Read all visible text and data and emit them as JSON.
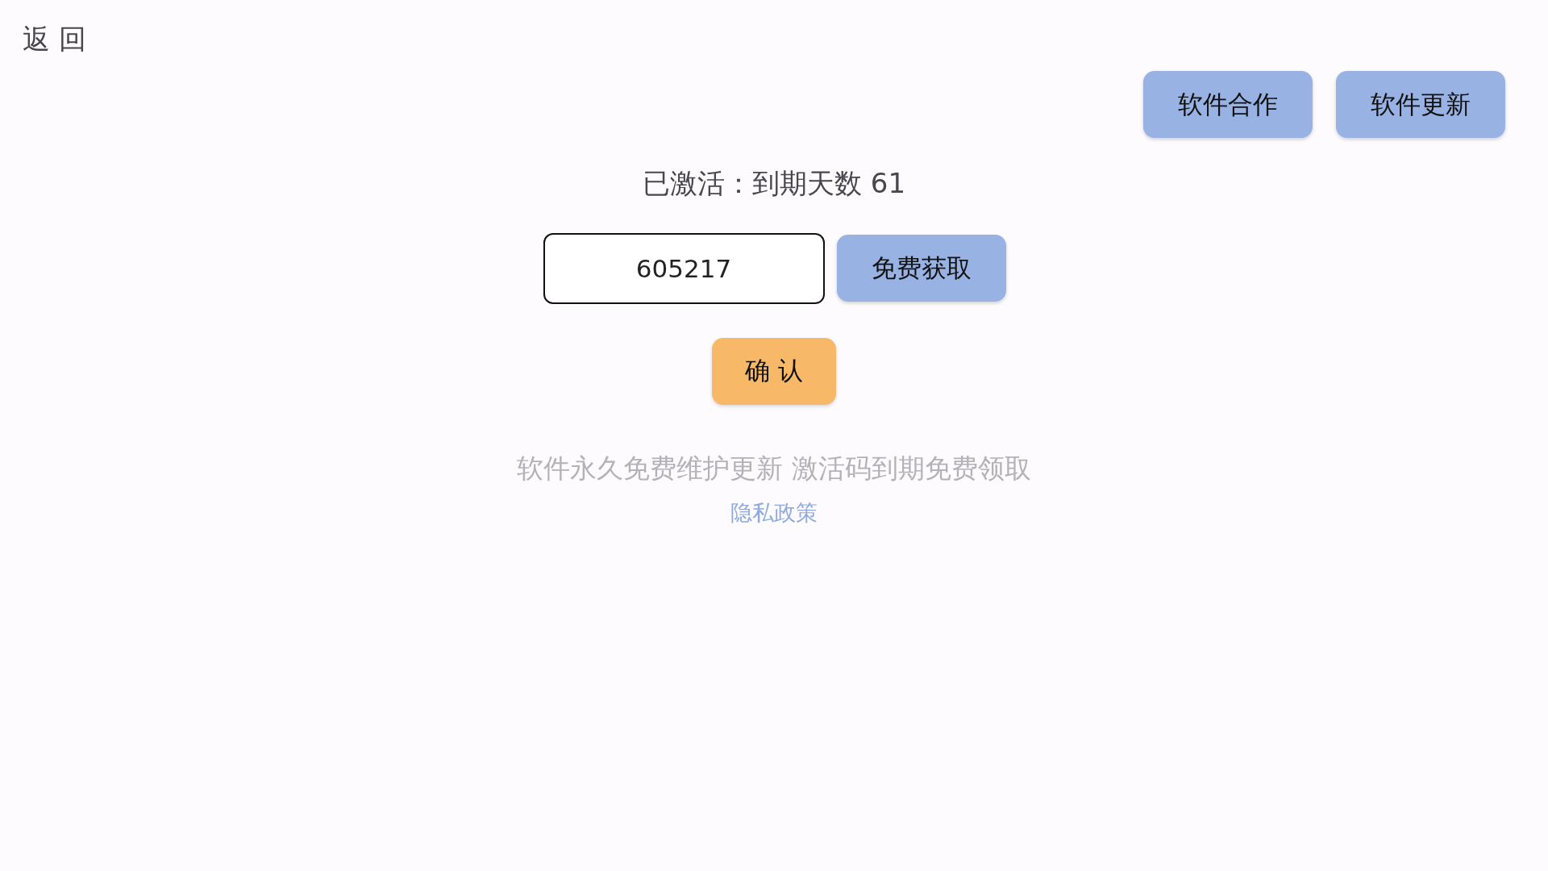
{
  "back_button": "返 回",
  "header_buttons": [
    "软件合作",
    "软件更新"
  ],
  "status": "已激活：到期天数 61",
  "activation_code": {
    "value": "605217"
  },
  "get_free_button": "免费获取",
  "confirm_button": "确 认",
  "notice": "软件永久免费维护更新 激活码到期免费领取",
  "privacy_link": "隐私政策"
}
